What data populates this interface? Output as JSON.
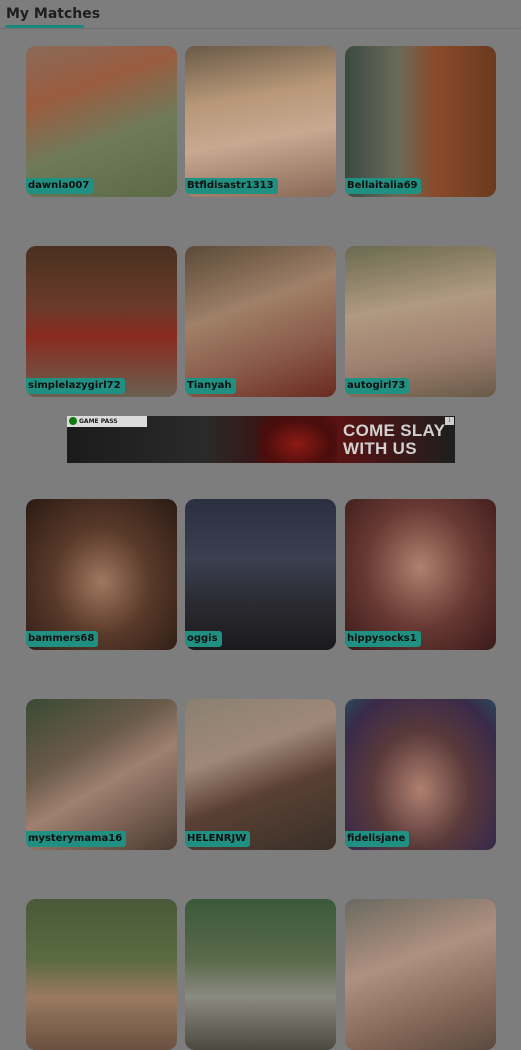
{
  "header": {
    "title": "My Matches"
  },
  "matches": [
    {
      "username": "dawnla007"
    },
    {
      "username": "Btfldisastr1313"
    },
    {
      "username": "Bellaitalia69"
    },
    {
      "username": "simplelazygirl72"
    },
    {
      "username": "Tianyah"
    },
    {
      "username": "autogirl73"
    },
    {
      "username": "bammers68"
    },
    {
      "username": "oggis"
    },
    {
      "username": "hippysocks1"
    },
    {
      "username": "mysterymama16"
    },
    {
      "username": "HELENRJW"
    },
    {
      "username": "fidelisjane"
    },
    {
      "username": ""
    },
    {
      "username": ""
    },
    {
      "username": ""
    }
  ],
  "ad": {
    "badge": "GAME PASS",
    "line1": "COME SLAY",
    "line2": "WITH US"
  },
  "colors": {
    "accent": "#1f9082",
    "overlay": "#7d7d7d"
  }
}
